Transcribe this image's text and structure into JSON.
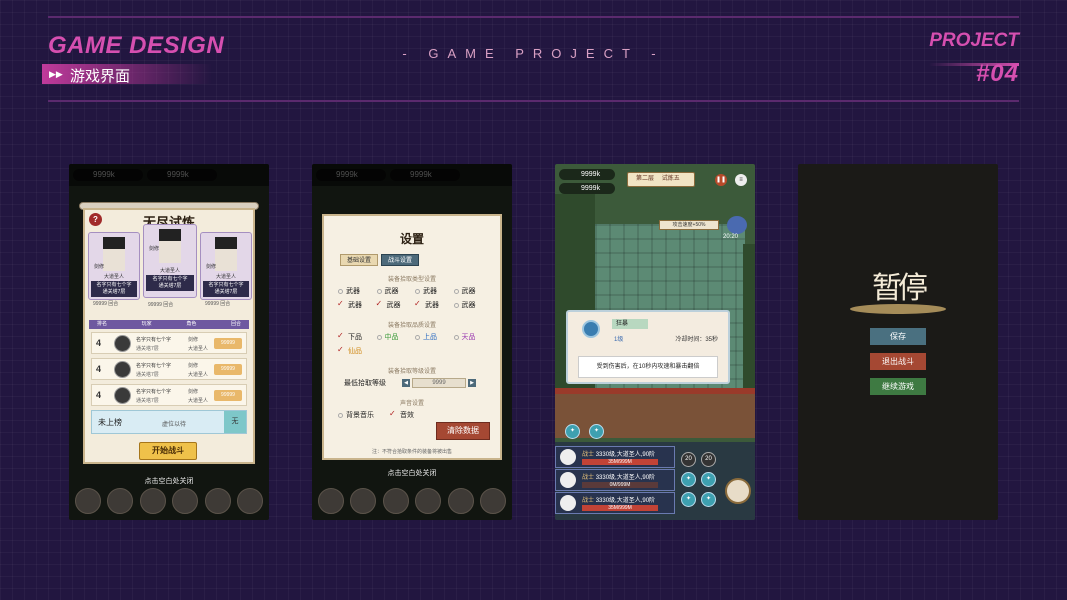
{
  "header": {
    "title": "GAME DESIGN",
    "subtitle": "游戏界面",
    "center_title": "- GAME PROJECT -",
    "project_label": "PROJECT",
    "project_number": "#04"
  },
  "colors": {
    "accent": "#d64fb0",
    "background": "#221640"
  },
  "screen1": {
    "coin1": "9999k",
    "coin2": "9999k",
    "title": "无尽试炼",
    "help": "?",
    "cards": [
      {
        "role": "剑修",
        "rank_label": "大道圣人",
        "name": "名字只有七个字",
        "floors": "通关塔7层",
        "score": "99999 回合"
      },
      {
        "role": "剑修",
        "rank_label": "大道圣人",
        "name": "名字只有七个字",
        "floors": "通关塔7层",
        "score": "99999 回合"
      },
      {
        "role": "剑修",
        "rank_label": "大道圣人",
        "name": "名字只有七个字",
        "floors": "通关塔7层",
        "score": "99999 回合"
      }
    ],
    "table_headers": [
      "排名",
      "玩家",
      "角色",
      "回合"
    ],
    "rows": [
      {
        "rank": "4",
        "name": "名字只有七个字",
        "floors": "通关塔7层",
        "role": "剑修",
        "rank_label": "大道圣人",
        "score": "99999"
      },
      {
        "rank": "4",
        "name": "名字只有七个字",
        "floors": "通关塔7层",
        "role": "剑修",
        "rank_label": "大道圣人",
        "score": "99999"
      },
      {
        "rank": "4",
        "name": "名字只有七个字",
        "floors": "通关塔7层",
        "role": "剑修",
        "rank_label": "大道圣人",
        "score": "99999"
      }
    ],
    "self_row": {
      "label": "未上榜",
      "status": "虚位以待",
      "side": "无"
    },
    "start_button": "开始战斗",
    "close_hint": "点击空白处关闭"
  },
  "screen2": {
    "coin1": "9999k",
    "coin2": "9999k",
    "title": "设置",
    "tabs": [
      "基础设置",
      "战斗设置"
    ],
    "sec_type": "装备拾取类型设置",
    "type_items": [
      {
        "label": "武器",
        "on": false
      },
      {
        "label": "武器",
        "on": false
      },
      {
        "label": "武器",
        "on": false
      },
      {
        "label": "武器",
        "on": false
      },
      {
        "label": "武器",
        "on": true
      },
      {
        "label": "武器",
        "on": true
      },
      {
        "label": "武器",
        "on": true
      },
      {
        "label": "武器",
        "on": false
      }
    ],
    "sec_quality": "装备拾取品质设置",
    "quality_items": [
      {
        "label": "下品",
        "on": true,
        "color": "#222222"
      },
      {
        "label": "中品",
        "on": false,
        "color": "#3a9a3a"
      },
      {
        "label": "上品",
        "on": false,
        "color": "#2a6ac0"
      },
      {
        "label": "天品",
        "on": false,
        "color": "#9a3ab0"
      },
      {
        "label": "仙品",
        "on": true,
        "color": "#d08a1a"
      }
    ],
    "sec_level": "装备拾取等级设置",
    "level_label": "最低拾取等级",
    "level_value": "9999",
    "sec_sound": "声音设置",
    "sound_items": [
      {
        "label": "背景音乐",
        "on": false
      },
      {
        "label": "音效",
        "on": true
      }
    ],
    "clear_button": "清除数据",
    "note": "注：不符合拾取条件的装备将被出售",
    "close_hint": "点击空白处关闭"
  },
  "screen3": {
    "res1": "9999k",
    "res2": "9999k",
    "floor": "第二层",
    "stage": "试炼五",
    "speed": "攻击速度+50%",
    "timer": "20:20",
    "skill_popup": {
      "name": "狂暴",
      "level": "1级",
      "cooldown": "冷却时间：35秒",
      "desc": "受到伤害后，在10秒内攻速和暴击翻倍"
    },
    "party": [
      {
        "class": "战士",
        "info": "3330级,大道圣人,90阶",
        "hp": "35M/999M"
      },
      {
        "class": "战士",
        "info": "3330级,大道圣人,90阶",
        "hp": "0M/999M"
      },
      {
        "class": "战士",
        "info": "3330级,大道圣人,90阶",
        "hp": "35M/999M"
      }
    ],
    "skill_counts": [
      "20",
      "20"
    ]
  },
  "screen4": {
    "pause_title": "暂停",
    "buttons": [
      {
        "label": "保存",
        "color": "#4a7080"
      },
      {
        "label": "退出战斗",
        "color": "#a54833"
      },
      {
        "label": "继续游戏",
        "color": "#3e7a42"
      }
    ]
  }
}
